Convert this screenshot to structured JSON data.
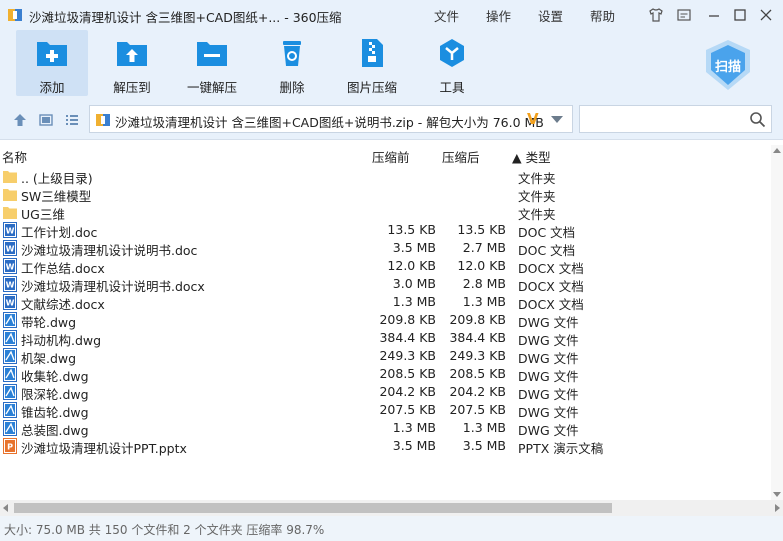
{
  "window": {
    "title": "沙滩垃圾清理机设计 含三维图+CAD图纸+...  - 360压缩",
    "menus": [
      "文件",
      "操作",
      "设置",
      "帮助"
    ]
  },
  "toolbar": {
    "buttons": [
      {
        "label": "添加",
        "icon": "add-icon"
      },
      {
        "label": "解压到",
        "icon": "extract-to-icon"
      },
      {
        "label": "一键解压",
        "icon": "one-click-extract-icon"
      },
      {
        "label": "删除",
        "icon": "delete-icon"
      },
      {
        "label": "图片压缩",
        "icon": "image-compress-icon"
      },
      {
        "label": "工具",
        "icon": "tools-icon"
      }
    ],
    "scan_label": "扫描"
  },
  "address": {
    "path": "沙滩垃圾清理机设计 含三维图+CAD图纸+说明书.zip - 解包大小为 76.0 MB",
    "search_placeholder": ""
  },
  "columns": {
    "name": "名称",
    "compressed": "压缩前",
    "size": "压缩后",
    "type": "▲ 类型"
  },
  "files": [
    {
      "name": ".. (上级目录)",
      "compressed": "",
      "size": "",
      "type": "文件夹",
      "kind": "folder"
    },
    {
      "name": "SW三维模型",
      "compressed": "",
      "size": "",
      "type": "文件夹",
      "kind": "folder"
    },
    {
      "name": "UG三维",
      "compressed": "",
      "size": "",
      "type": "文件夹",
      "kind": "folder"
    },
    {
      "name": "工作计划.doc",
      "compressed": "13.5 KB",
      "size": "13.5 KB",
      "type": "DOC 文档",
      "kind": "word"
    },
    {
      "name": "沙滩垃圾清理机设计说明书.doc",
      "compressed": "3.5 MB",
      "size": "2.7 MB",
      "type": "DOC 文档",
      "kind": "word"
    },
    {
      "name": "工作总结.docx",
      "compressed": "12.0 KB",
      "size": "12.0 KB",
      "type": "DOCX 文档",
      "kind": "word"
    },
    {
      "name": "沙滩垃圾清理机设计说明书.docx",
      "compressed": "3.0 MB",
      "size": "2.8 MB",
      "type": "DOCX 文档",
      "kind": "word"
    },
    {
      "name": "文献综述.docx",
      "compressed": "1.3 MB",
      "size": "1.3 MB",
      "type": "DOCX 文档",
      "kind": "word"
    },
    {
      "name": "带轮.dwg",
      "compressed": "209.8 KB",
      "size": "209.8 KB",
      "type": "DWG 文件",
      "kind": "dwg"
    },
    {
      "name": "抖动机构.dwg",
      "compressed": "384.4 KB",
      "size": "384.4 KB",
      "type": "DWG 文件",
      "kind": "dwg"
    },
    {
      "name": "机架.dwg",
      "compressed": "249.3 KB",
      "size": "249.3 KB",
      "type": "DWG 文件",
      "kind": "dwg"
    },
    {
      "name": "收集轮.dwg",
      "compressed": "208.5 KB",
      "size": "208.5 KB",
      "type": "DWG 文件",
      "kind": "dwg"
    },
    {
      "name": "限深轮.dwg",
      "compressed": "204.2 KB",
      "size": "204.2 KB",
      "type": "DWG 文件",
      "kind": "dwg"
    },
    {
      "name": "锥齿轮.dwg",
      "compressed": "207.5 KB",
      "size": "207.5 KB",
      "type": "DWG 文件",
      "kind": "dwg"
    },
    {
      "name": "总装图.dwg",
      "compressed": "1.3 MB",
      "size": "1.3 MB",
      "type": "DWG 文件",
      "kind": "dwg"
    },
    {
      "name": "沙滩垃圾清理机设计PPT.pptx",
      "compressed": "3.5 MB",
      "size": "3.5 MB",
      "type": "PPTX 演示文稿",
      "kind": "ppt"
    }
  ],
  "status": "大小: 75.0 MB 共 150 个文件和 2 个文件夹 压缩率 98.7%",
  "colors": {
    "chrome_bg": "#e8f1fb",
    "accent_blue": "#1b8ee0",
    "folder": "#f7ce6b",
    "ppt": "#e8732d",
    "path_v": "#f2a01c"
  }
}
